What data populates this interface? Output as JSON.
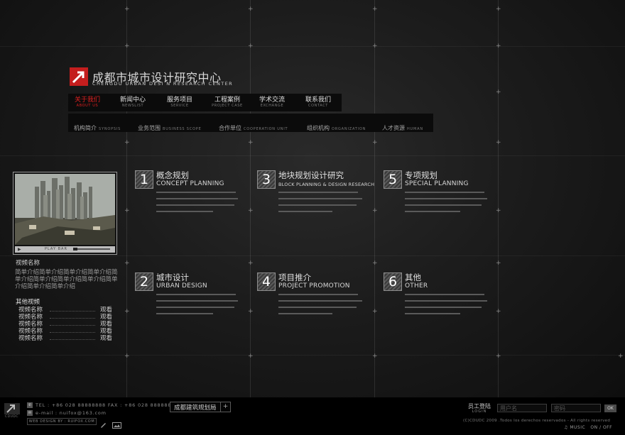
{
  "brand": {
    "name_cn": "成都市城市设计研究中心",
    "name_en": "CHENGDU URBAN DESI N RESEARCH CENTER",
    "accent_color": "#c41e1e"
  },
  "main_nav": [
    {
      "cn": "关于我们",
      "en": "ABOUT US",
      "active": true
    },
    {
      "cn": "新闻中心",
      "en": "NEWSLIST",
      "active": false
    },
    {
      "cn": "服务项目",
      "en": "SERVICE",
      "active": false
    },
    {
      "cn": "工程案例",
      "en": "PROJECT CASE",
      "active": false
    },
    {
      "cn": "学术交流",
      "en": "EXCHANGE",
      "active": false
    },
    {
      "cn": "联系我们",
      "en": "CONTACT",
      "active": false
    }
  ],
  "sub_nav": [
    {
      "cn": "机构简介",
      "en": "SYNOPSIS"
    },
    {
      "cn": "业务范围",
      "en": "BUSINESS SCOPE"
    },
    {
      "cn": "合作单位",
      "en": "COOPERATION UNIT"
    },
    {
      "cn": "组织机构",
      "en": "ORGANIZATION"
    },
    {
      "cn": "人才资源",
      "en": "HUMAN"
    }
  ],
  "video": {
    "play_bar_label": "PLAY BAR",
    "play_icon": "play-icon",
    "title": "视频名称",
    "description": "简单介绍简单介绍简单介绍简单介绍简单介绍简单介绍简单介绍简单介绍简单介绍简单介绍简单介绍"
  },
  "other_videos": {
    "title": "其他视频",
    "items": [
      {
        "name": "视频名称",
        "action": "观看"
      },
      {
        "name": "视频名称",
        "action": "观看"
      },
      {
        "name": "视频名称",
        "action": "观看"
      },
      {
        "name": "视频名称",
        "action": "观看"
      },
      {
        "name": "视频名称",
        "action": "观看"
      }
    ]
  },
  "services": [
    {
      "num": "1",
      "cn": "概念规划",
      "en": "CONCEPT PLANNING"
    },
    {
      "num": "3",
      "cn": "地块规划设计研究",
      "en": "BLOCK PLANNING & DESIGN RESEARCH"
    },
    {
      "num": "5",
      "cn": "专项规划",
      "en": "SPECIAL PLANNING"
    },
    {
      "num": "2",
      "cn": "城市设计",
      "en": "URBAN DESIGN"
    },
    {
      "num": "4",
      "cn": "项目推介",
      "en": "PROJECT PROMOTION"
    },
    {
      "num": "6",
      "cn": "其他",
      "en": "OTHER"
    }
  ],
  "footer": {
    "logo_text": "CDUDC",
    "tel": "TEL : +86 028 88888888   FAX : +86 028 88888888",
    "email": "e-mail : nuifox@163.com",
    "design_credit": "WEB DESIGN BY : RUIFOX.COM",
    "site_select": "成都建筑规划局",
    "site_select_btn": "+",
    "login_cn": "员工登陆",
    "login_en": "LOGIN",
    "username_placeholder": "用户名",
    "password_placeholder": "密码",
    "ok_label": "OK",
    "copyright": "(C)CDUDC 2009 .Todos los derechos reservados - All rights reserved",
    "music_label": "MUSIC",
    "music_on": "ON",
    "music_off": "OFF"
  }
}
